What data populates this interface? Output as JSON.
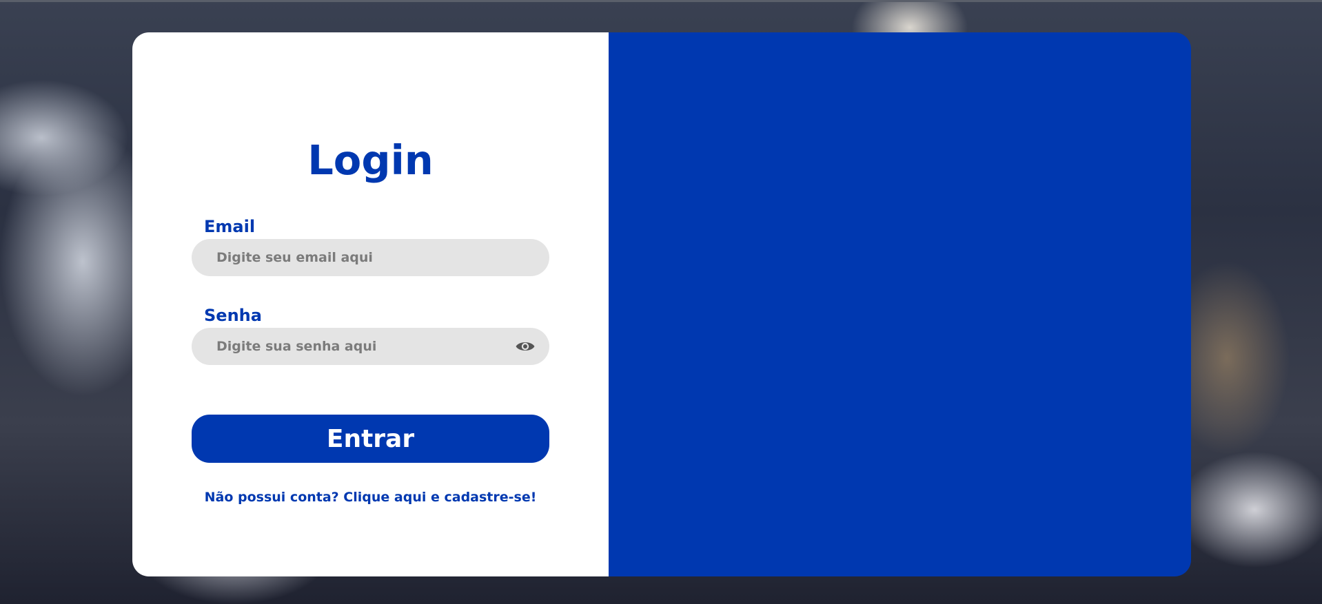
{
  "colors": {
    "brand": "#0038b0",
    "field_bg": "#e4e4e4",
    "card_bg": "#ffffff",
    "placeholder": "#7b7b7b",
    "eye_icon": "#555555"
  },
  "login": {
    "title": "Login",
    "email": {
      "label": "Email",
      "placeholder": "Digite seu email aqui"
    },
    "password": {
      "label": "Senha",
      "placeholder": "Digite sua senha aqui",
      "toggle_icon": "eye-icon"
    },
    "submit_label": "Entrar",
    "signup_text": "Não possui conta? Clique aqui e cadastre-se!"
  }
}
